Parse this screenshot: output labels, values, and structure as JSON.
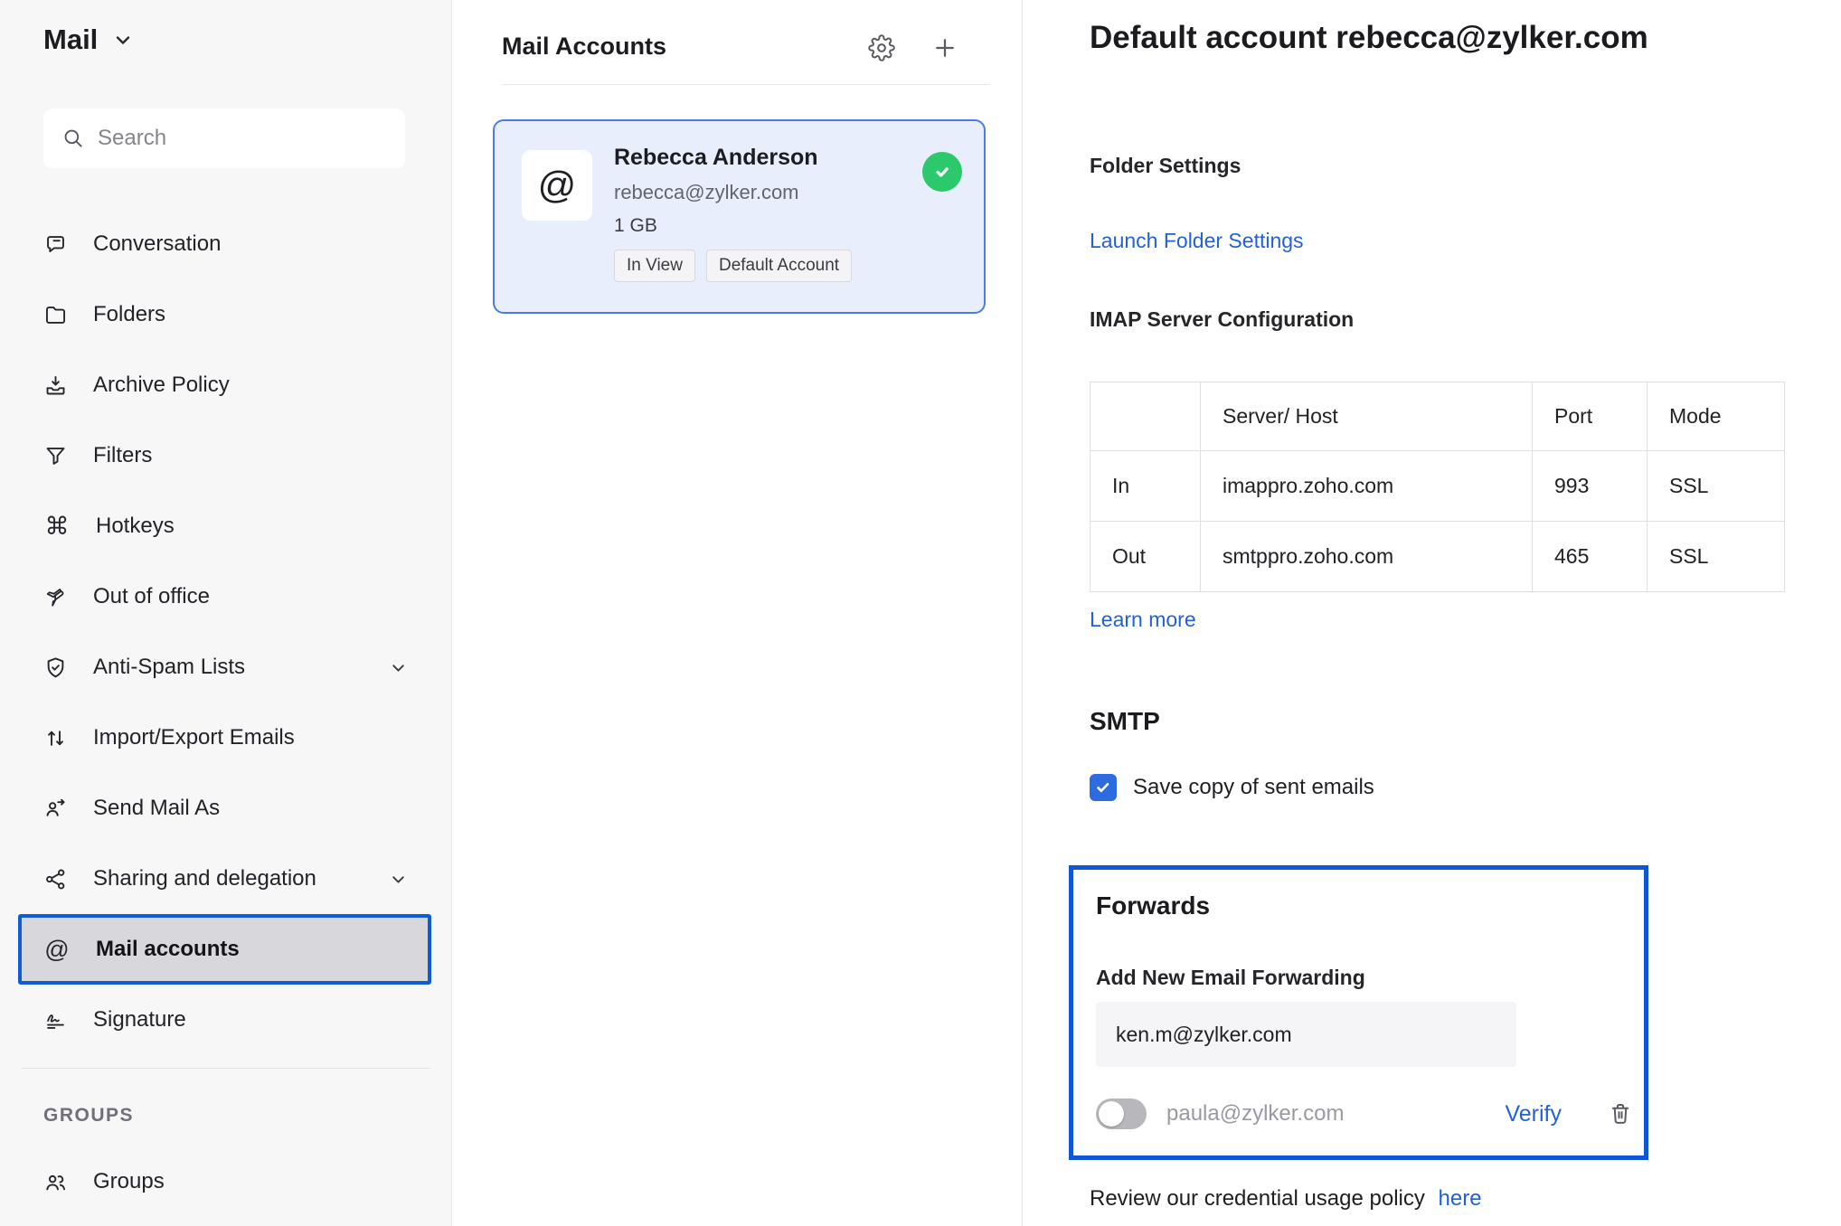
{
  "sidebar": {
    "title": "Mail",
    "search_placeholder": "Search",
    "items": [
      {
        "label": "Conversation",
        "icon": "conversation-icon"
      },
      {
        "label": "Folders",
        "icon": "folder-icon"
      },
      {
        "label": "Archive Policy",
        "icon": "archive-icon"
      },
      {
        "label": "Filters",
        "icon": "filter-icon"
      },
      {
        "label": "Hotkeys",
        "icon": "command-icon",
        "glyph": "⌘"
      },
      {
        "label": "Out of office",
        "icon": "airplane-icon"
      },
      {
        "label": "Anti-Spam Lists",
        "icon": "shield-check-icon",
        "expandable": true
      },
      {
        "label": "Import/Export Emails",
        "icon": "arrows-up-down-icon"
      },
      {
        "label": "Send Mail As",
        "icon": "person-send-icon"
      },
      {
        "label": "Sharing and delegation",
        "icon": "share-nodes-icon",
        "expandable": true
      },
      {
        "label": "Mail accounts",
        "icon": "at-sign-icon",
        "glyph": "@",
        "selected": true
      },
      {
        "label": "Signature",
        "icon": "signature-icon"
      }
    ],
    "groups_header": "GROUPS",
    "groups_item": {
      "label": "Groups",
      "icon": "people-icon"
    }
  },
  "accounts_panel": {
    "title": "Mail Accounts",
    "card": {
      "at_glyph": "@",
      "name": "Rebecca Anderson",
      "email": "rebecca@zylker.com",
      "storage": "1 GB",
      "badges": [
        "In View",
        "Default Account"
      ],
      "status_icon": "green-check-icon"
    }
  },
  "detail": {
    "title": "Default account rebecca@zylker.com",
    "folder_settings_heading": "Folder Settings",
    "launch_link": "Launch Folder Settings",
    "imap_heading": "IMAP Server Configuration",
    "table": {
      "headers": [
        "",
        "Server/ Host",
        "Port",
        "Mode"
      ],
      "rows": [
        [
          "In",
          "imappro.zoho.com",
          "993",
          "SSL"
        ],
        [
          "Out",
          "smtppro.zoho.com",
          "465",
          "SSL"
        ]
      ]
    },
    "learn_more": "Learn more",
    "smtp_heading": "SMTP",
    "save_copy_label": "Save copy of sent emails",
    "save_copy_checked": true,
    "forwards": {
      "heading": "Forwards",
      "add_label": "Add New Email Forwarding",
      "input_value": "ken.m@zylker.com",
      "pending_email": "paula@zylker.com",
      "toggle_state": "off",
      "verify_label": "Verify"
    },
    "policy_text": "Review our credential usage policy",
    "policy_link": "here"
  },
  "colors": {
    "accent_blue": "#0E5CD7",
    "forwards_border_blue": "#0E56D4",
    "card_border_blue": "#4B7CE5",
    "card_bg": "#E9EEFC",
    "link_blue": "#2261D7",
    "checkbox_blue": "#2D6BE0",
    "success_green": "#2BC96C",
    "sidebar_bg": "#F7F7F8",
    "selected_item_bg": "#D8D8DC",
    "toggle_off_gray": "#B7B7BC",
    "muted_text": "#64646D"
  }
}
